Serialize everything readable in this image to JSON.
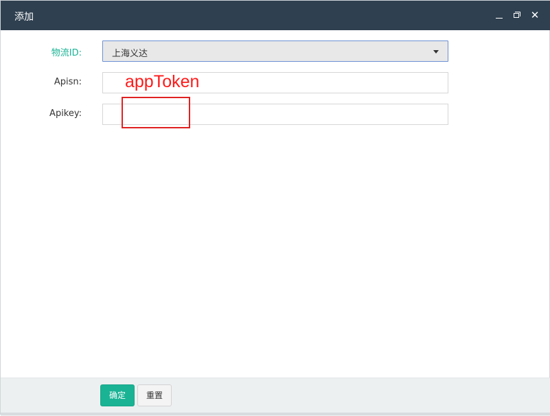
{
  "window": {
    "title": "添加",
    "minimize_icon": "minimize-icon",
    "maximize_icon": "restore-icon",
    "close_icon": "close-icon",
    "close_glyph": "✕"
  },
  "form": {
    "logistics_label": "物流ID:",
    "logistics_value": "上海义达",
    "apisn_label": "Apisn:",
    "apisn_value": "",
    "apikey_label": "Apikey:",
    "apikey_value": ""
  },
  "annotation": {
    "text": "appToken",
    "color": "#ff1a1a"
  },
  "footer": {
    "confirm_label": "确定",
    "reset_label": "重置"
  },
  "colors": {
    "titlebar": "#2f4050",
    "accent": "#1ab394",
    "footer_bg": "#edf0f1"
  }
}
